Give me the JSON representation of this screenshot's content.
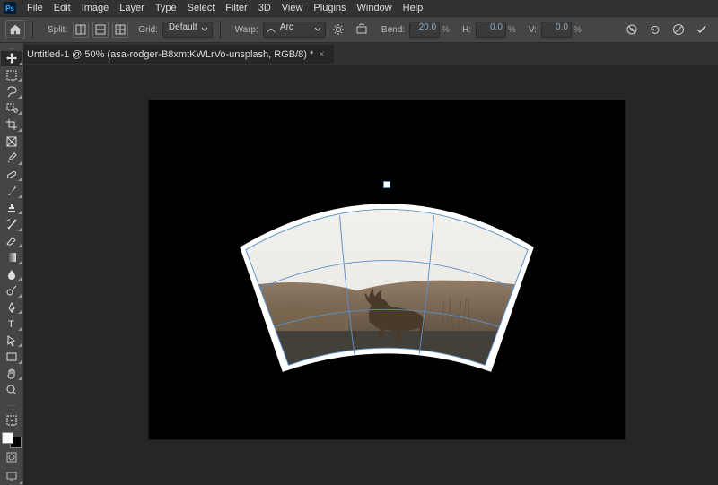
{
  "app": {
    "logo": "Ps"
  },
  "menu": [
    "File",
    "Edit",
    "Image",
    "Layer",
    "Type",
    "Select",
    "Filter",
    "3D",
    "View",
    "Plugins",
    "Window",
    "Help"
  ],
  "options": {
    "split_label": "Split:",
    "grid_label": "Grid:",
    "grid_value": "Default",
    "warp_label": "Warp:",
    "warp_value": "Arc",
    "bend_label": "Bend:",
    "bend_value": "20.0",
    "h_label": "H:",
    "h_value": "0.0",
    "v_label": "V:",
    "v_value": "0.0",
    "pct": "%"
  },
  "tab": {
    "title": "Untitled-1 @ 50% (asa-rodger-B8xmtKWLrVo-unsplash, RGB/8) *"
  }
}
